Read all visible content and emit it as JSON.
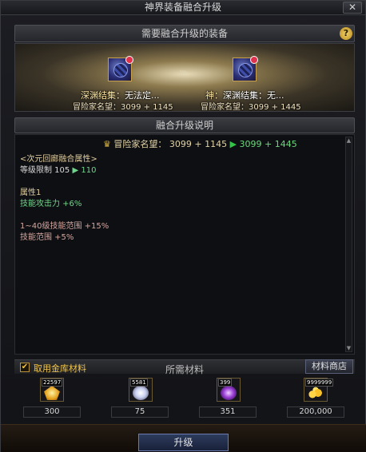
{
  "window": {
    "title": "神界装备融合升级",
    "close_label": "✕"
  },
  "equip_panel": {
    "header": "需要融合升级的装备",
    "help_label": "?"
  },
  "source_item": {
    "name_prefix": "深渊结集：",
    "name_rest": "无法定...",
    "reputation": "冒险家名望：3099 + 1145"
  },
  "arrows": "›››",
  "target_item": {
    "name_prefix": "神：",
    "name_rest": "深渊结集：无...",
    "reputation": "冒险家名望：3099 + 1445"
  },
  "description": {
    "header": "融合升级说明",
    "rep_label": "冒险家名望：",
    "rep_from": "3099 + 1145",
    "rep_to": "3099 + 1445",
    "lines": [
      {
        "text": "<次元回廊融合属性>",
        "kind": "head"
      },
      {
        "text": "等级限制 105",
        "arrow": "▶",
        "extra": "110",
        "kind": "white"
      },
      {
        "text": "属性1",
        "kind": "head"
      },
      {
        "text": "技能攻击力 +6%",
        "kind": "green"
      },
      {
        "text": "1~40级技能范围 +15%",
        "kind": "pink"
      },
      {
        "text": "技能范围 +5%",
        "kind": "pink"
      }
    ]
  },
  "materials": {
    "checkbox_label": "取用金库材料",
    "title": "所需材料",
    "shop_button": "材料商店",
    "items": [
      {
        "icon": "gold-crystal-icon",
        "stock": "22597",
        "required": "300"
      },
      {
        "icon": "white-orb-icon",
        "stock": "5581",
        "required": "75"
      },
      {
        "icon": "purple-orb-icon",
        "stock": "399",
        "required": "351"
      },
      {
        "icon": "gold-coins-icon",
        "stock": "9999999",
        "required": "200,000"
      }
    ]
  },
  "upgrade_button": "升级"
}
